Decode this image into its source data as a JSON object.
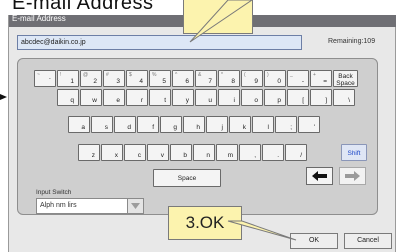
{
  "page_heading": "E-mail Address",
  "window": {
    "title": "E-mail Address"
  },
  "email": {
    "value": "abcdec@daikin.co.jp",
    "remaining_label": "Remaining:109"
  },
  "keyboard": {
    "row1": [
      {
        "main": "1",
        "shift": "!"
      },
      {
        "main": "2",
        "shift": "@"
      },
      {
        "main": "3",
        "shift": "#"
      },
      {
        "main": "4",
        "shift": "$"
      },
      {
        "main": "5",
        "shift": "%"
      },
      {
        "main": "6",
        "shift": "^"
      },
      {
        "main": "7",
        "shift": "&"
      },
      {
        "main": "8",
        "shift": "*"
      },
      {
        "main": "9",
        "shift": "("
      },
      {
        "main": "0",
        "shift": ")"
      },
      {
        "main": "-",
        "shift": "_"
      },
      {
        "main": "=",
        "shift": "+"
      }
    ],
    "row1_first": {
      "main": "`",
      "shift": "~"
    },
    "backspace_label": "Back Space",
    "row2": [
      "q",
      "w",
      "e",
      "r",
      "t",
      "y",
      "u",
      "i",
      "o",
      "p",
      "[",
      "]",
      "\\"
    ],
    "row3": [
      "a",
      "s",
      "d",
      "f",
      "g",
      "h",
      "j",
      "k",
      "l",
      ";",
      "'"
    ],
    "row4": [
      "z",
      "x",
      "c",
      "v",
      "b",
      "n",
      "m",
      ",",
      ".",
      "/"
    ],
    "shift_label": "Shift",
    "space_label": "Space"
  },
  "input_switch": {
    "label": "Input Switch",
    "value": "Alph nm lirs"
  },
  "buttons": {
    "ok": "OK",
    "cancel": "Cancel"
  },
  "callout_ok": "3.OK",
  "colors": {
    "title_bar": "#6f6f74",
    "callout": "#fcf3ae",
    "shift_text": "#1b46c8"
  }
}
